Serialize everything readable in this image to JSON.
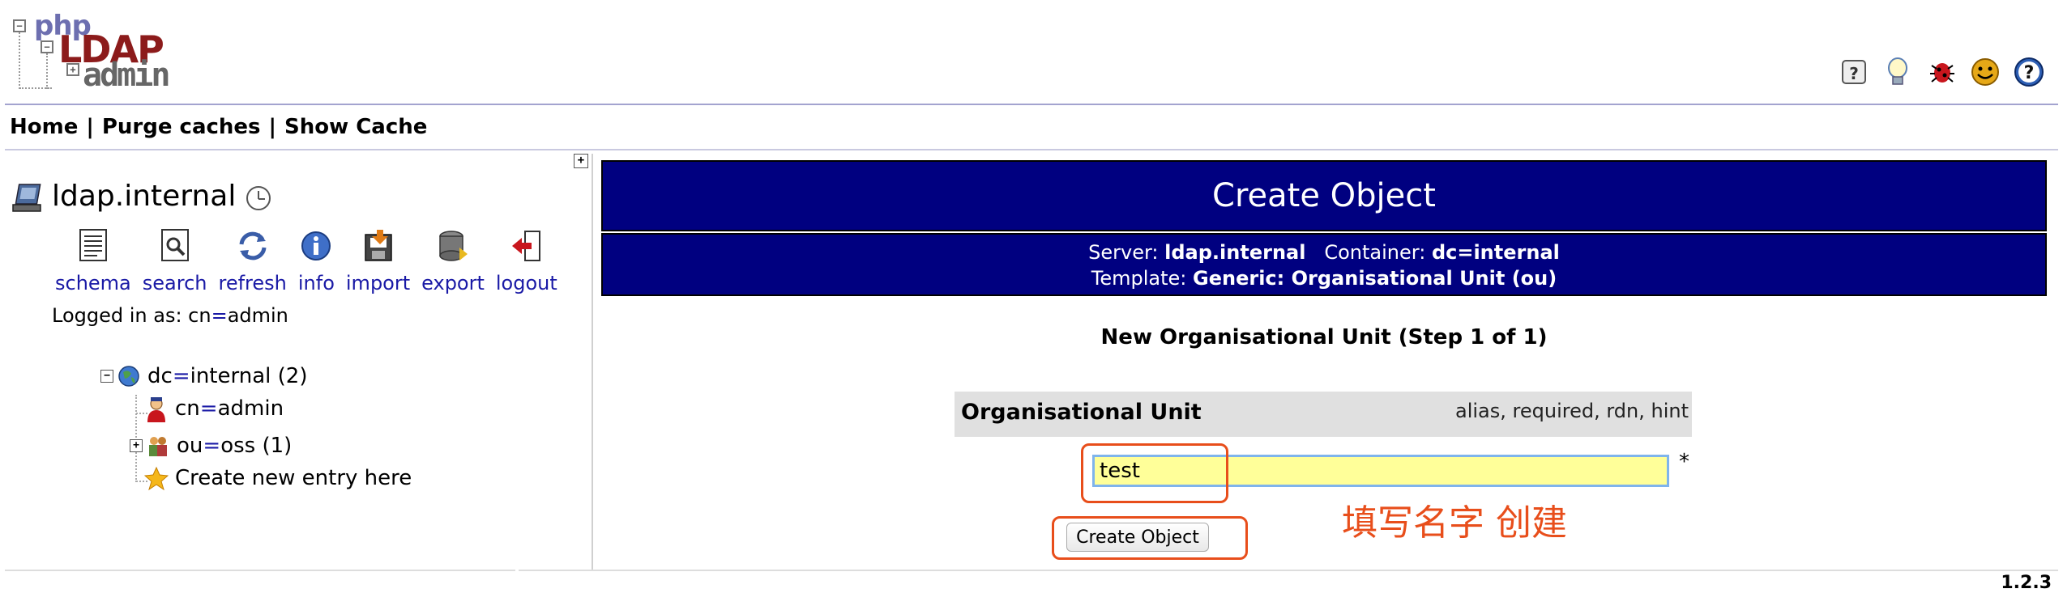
{
  "logo": {
    "line1": "php",
    "line2": "LDAP",
    "line3": "admin"
  },
  "top_icons": [
    "question-mark-icon",
    "lightbulb-icon",
    "bug-icon",
    "smiley-icon",
    "help-icon"
  ],
  "nav": [
    {
      "label": "Home"
    },
    {
      "label": "Purge caches"
    },
    {
      "label": "Show Cache"
    }
  ],
  "nav_separator": "|",
  "expand_symbol": "+",
  "server": {
    "name": "ldap.internal"
  },
  "tools": [
    {
      "label": "schema",
      "icon": "schema-icon"
    },
    {
      "label": "search",
      "icon": "search-icon"
    },
    {
      "label": "refresh",
      "icon": "refresh-icon"
    },
    {
      "label": "info",
      "icon": "info-icon"
    },
    {
      "label": "import",
      "icon": "import-icon"
    },
    {
      "label": "export",
      "icon": "export-icon"
    },
    {
      "label": "logout",
      "icon": "logout-icon"
    }
  ],
  "logged_in": {
    "prefix": "Logged in as: ",
    "attr": "cn",
    "eq": "=",
    "value": "admin"
  },
  "tree": {
    "root": {
      "toggle": "−",
      "attr": "dc",
      "value": "internal",
      "count": "(2)"
    },
    "children": [
      {
        "attr": "cn",
        "value": "admin",
        "count": ""
      },
      {
        "toggle": "+",
        "attr": "ou",
        "value": "oss",
        "count": "(1)"
      }
    ],
    "create_label": "Create new entry here"
  },
  "main": {
    "title": "Create Object",
    "server_label": "Server:",
    "server_value": "ldap.internal",
    "container_label": "Container:",
    "container_value": "dc=internal",
    "template_label": "Template:",
    "template_value": "Generic: Organisational Unit (ou)",
    "step_title": "New Organisational Unit (Step 1 of 1)",
    "attribute": {
      "name": "Organisational Unit",
      "hint": "alias, required, rdn, hint",
      "value": "test",
      "required_mark": "*"
    },
    "submit_label": "Create Object",
    "annotation": "填写名字 创建"
  },
  "footer": {
    "page": "1.2.3"
  },
  "colors": {
    "title_bg": "#000080",
    "link": "#1a1aa6",
    "annotation": "#e84e1b",
    "input_bg": "#ffff99"
  }
}
